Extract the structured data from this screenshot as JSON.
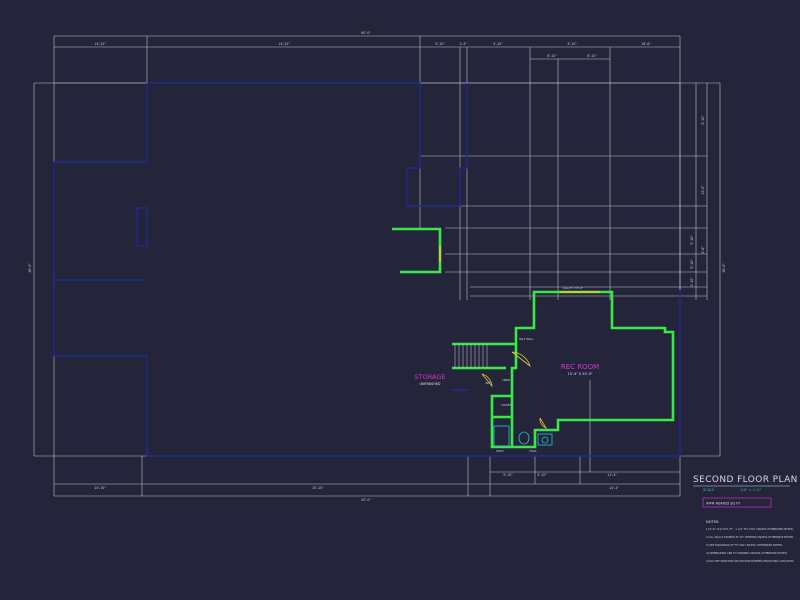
{
  "plan": {
    "title": "SECOND FLOOR PLAN",
    "scale_label": "SCALE",
    "scale_value": "1/4\" = 1'-0\"",
    "area": "### HEATED SQ FT"
  },
  "rooms": {
    "storage_name": "STORAGE",
    "storage_sub": "UNFINISHED",
    "rec_name": "REC ROOM",
    "rec_size": "15'-4\" X 23'-9\""
  },
  "dimensions": {
    "top_overall": "60'-0\"",
    "top_segments": [
      "14'-10\"",
      "14'-10\"",
      "5'-10\"",
      "1'-4\"",
      "5'-10\"",
      "3'-10\"",
      "16'-6\""
    ],
    "top_sub": [
      "6'-10\"",
      "6'-10\""
    ],
    "bottom_overall": "50'-0\"",
    "bottom_segments": [
      "14'-10\"",
      "20'-10\"",
      "14'-4\""
    ],
    "bottom_inner": [
      "5'-10\"",
      "5'-10\"",
      "11'-4\""
    ],
    "left_overall": "36'-0\"",
    "right_overall": "36'-0\"",
    "right_segments": [
      "5'-10\"",
      "12'-0\"",
      "1'-6\"",
      "5'-10\"",
      "5'-10\"",
      "1'-10\""
    ]
  },
  "labels": {
    "wall_rec_top": "CLG HT = 8'-0\"",
    "half_wall": "HALF WALL",
    "closet": "CLOSET",
    "bath": "BATH",
    "hvac": "HVAC",
    "opt": "OPT",
    "linen": "LINEN"
  },
  "notes": {
    "heading": "NOTES:",
    "items": [
      "1) 9'-6\" CLG HGT, FF - 1 1/2\" FLT. HGT. UNLESS OTHERWISE NOTED.",
      "2) ALL WALLS FRAMED AT 16\" CENTERS UNLESS OTHERWISE NOTED.",
      "3) SEE DRAWINGS OF FIT MAY UNLESS OTHERWISE NOTED.",
      "4) DIMENSIONS ARE TO FRAMING UNLESS OTHERWISE NOTED.",
      "5) LOCALLY VERIFY MANUFACTURER'S SPECS FOR ROOFING REQUIREMENTS, PRESSURE RATINGS, & DESIGN OPTIONS."
    ]
  },
  "colors": {
    "background": "#24243a",
    "outline": "#1e2b8f",
    "finished_wall": "#39e845",
    "dimension": "#c9cbd8",
    "room_label": "#d533d0",
    "accent": "#29c4d6"
  }
}
